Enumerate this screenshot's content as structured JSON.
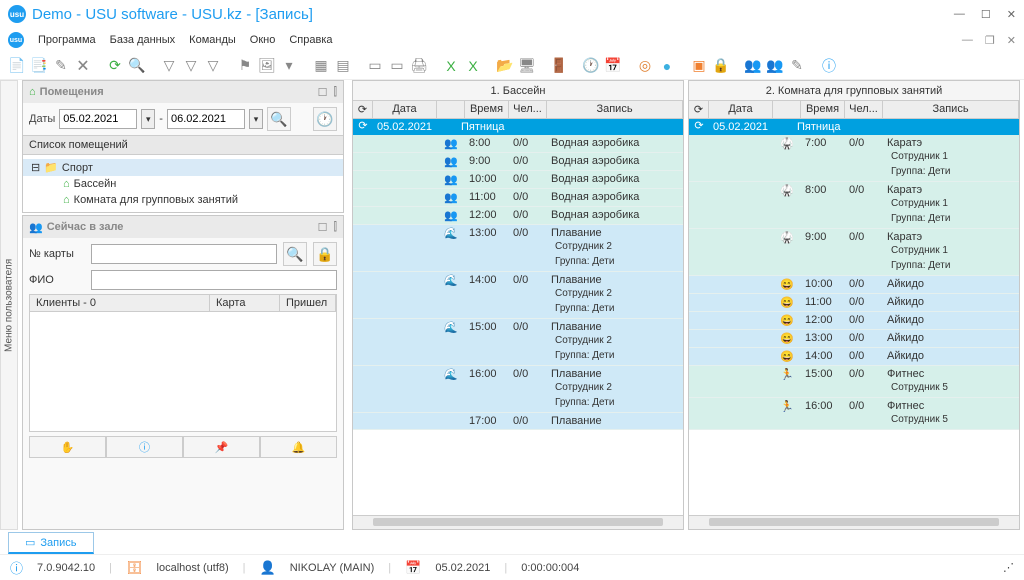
{
  "window": {
    "title": "Demo - USU software - USU.kz - [Запись]"
  },
  "menu": {
    "items": [
      "Программа",
      "База данных",
      "Команды",
      "Окно",
      "Справка"
    ]
  },
  "panels": {
    "rooms": {
      "title": "Помещения",
      "dates_label": "Даты",
      "date_from": "05.02.2021",
      "date_to": "06.02.2021",
      "list_title": "Список помещений",
      "root": "Спорт",
      "children": [
        "Бассейн",
        "Комната для групповых занятий"
      ]
    },
    "now": {
      "title": "Сейчас в зале",
      "card_label": "№ карты",
      "fio_label": "ФИО",
      "clients_col": "Клиенты - 0",
      "card_col": "Карта",
      "arrived_col": "Пришел"
    }
  },
  "schedules": [
    {
      "title": "1. Бассейн",
      "cols": [
        "Дата",
        "",
        "Время",
        "Чел...",
        "Запись"
      ],
      "date": "05.02.2021",
      "day": "Пятница",
      "rows": [
        {
          "cls": "a",
          "ico": "👥",
          "time": "8:00",
          "ppl": "0/0",
          "rec": "Водная аэробика"
        },
        {
          "cls": "a",
          "ico": "👥",
          "time": "9:00",
          "ppl": "0/0",
          "rec": "Водная аэробика"
        },
        {
          "cls": "a",
          "ico": "👥",
          "time": "10:00",
          "ppl": "0/0",
          "rec": "Водная аэробика"
        },
        {
          "cls": "a",
          "ico": "👥",
          "time": "11:00",
          "ppl": "0/0",
          "rec": "Водная аэробика"
        },
        {
          "cls": "a",
          "ico": "👥",
          "time": "12:00",
          "ppl": "0/0",
          "rec": "Водная аэробика"
        },
        {
          "cls": "b",
          "ico": "🌊",
          "time": "13:00",
          "ppl": "0/0",
          "rec": "Плавание\nСотрудник 2\nГруппа: Дети"
        },
        {
          "cls": "b",
          "ico": "🌊",
          "time": "14:00",
          "ppl": "0/0",
          "rec": "Плавание\nСотрудник 2\nГруппа: Дети"
        },
        {
          "cls": "b",
          "ico": "🌊",
          "time": "15:00",
          "ppl": "0/0",
          "rec": "Плавание\nСотрудник 2\nГруппа: Дети"
        },
        {
          "cls": "b",
          "ico": "🌊",
          "time": "16:00",
          "ppl": "0/0",
          "rec": "Плавание\nСотрудник 2\nГруппа: Дети"
        },
        {
          "cls": "b",
          "ico": "",
          "time": "17:00",
          "ppl": "0/0",
          "rec": "Плавание"
        }
      ]
    },
    {
      "title": "2. Комната для групповых занятий",
      "cols": [
        "Дата",
        "",
        "Время",
        "Чел...",
        "Запись"
      ],
      "date": "05.02.2021",
      "day": "Пятница",
      "rows": [
        {
          "cls": "a",
          "ico": "🥋",
          "time": "7:00",
          "ppl": "0/0",
          "rec": "Каратэ\nСотрудник 1\nГруппа: Дети"
        },
        {
          "cls": "a",
          "ico": "🥋",
          "time": "8:00",
          "ppl": "0/0",
          "rec": "Каратэ\nСотрудник 1\nГруппа: Дети"
        },
        {
          "cls": "a",
          "ico": "🥋",
          "time": "9:00",
          "ppl": "0/0",
          "rec": "Каратэ\nСотрудник 1\nГруппа: Дети"
        },
        {
          "cls": "b",
          "ico": "😄",
          "time": "10:00",
          "ppl": "0/0",
          "rec": "Айкидо"
        },
        {
          "cls": "b",
          "ico": "😄",
          "time": "11:00",
          "ppl": "0/0",
          "rec": "Айкидо"
        },
        {
          "cls": "b",
          "ico": "😄",
          "time": "12:00",
          "ppl": "0/0",
          "rec": "Айкидо"
        },
        {
          "cls": "b",
          "ico": "😄",
          "time": "13:00",
          "ppl": "0/0",
          "rec": "Айкидо"
        },
        {
          "cls": "b",
          "ico": "😄",
          "time": "14:00",
          "ppl": "0/0",
          "rec": "Айкидо"
        },
        {
          "cls": "a",
          "ico": "🏃",
          "time": "15:00",
          "ppl": "0/0",
          "rec": "Фитнес\nСотрудник 5"
        },
        {
          "cls": "a",
          "ico": "🏃",
          "time": "16:00",
          "ppl": "0/0",
          "rec": "Фитнес\nСотрудник 5"
        }
      ]
    }
  ],
  "tab": {
    "label": "Запись"
  },
  "status": {
    "version": "7.0.9042.10",
    "db": "localhost (utf8)",
    "user": "NIKOLAY (MAIN)",
    "date": "05.02.2021",
    "time": "0:00:00:004"
  },
  "sidetab": "Меню пользователя"
}
